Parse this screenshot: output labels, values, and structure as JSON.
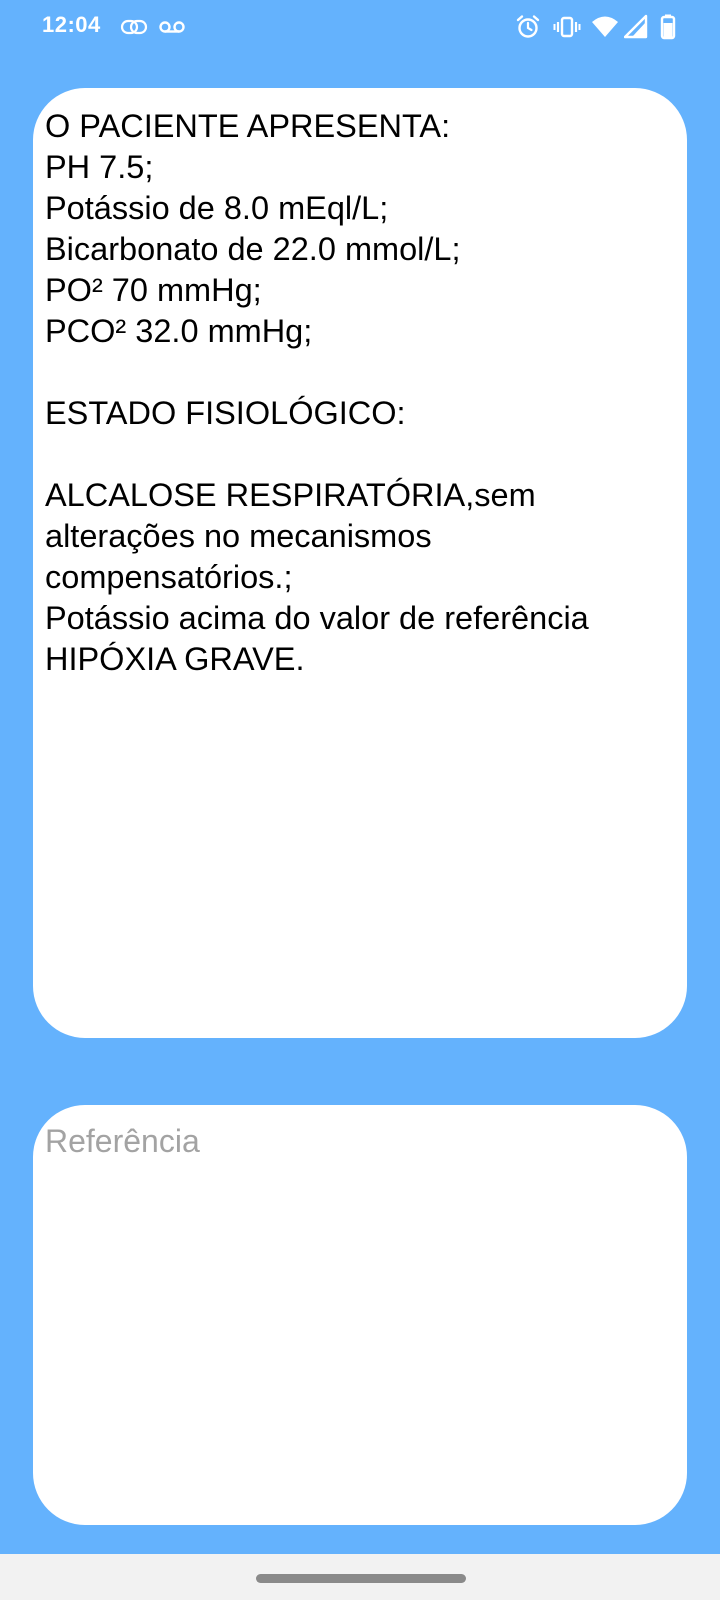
{
  "status_bar": {
    "time": "12:04",
    "left_icons": [
      "cloud-sync-icon",
      "voicemail-icon"
    ],
    "right_icons": [
      "alarm-icon",
      "vibrate-icon",
      "wifi-icon",
      "cellular-signal-icon",
      "battery-icon"
    ],
    "icon_color": "#ffffff"
  },
  "result": {
    "lines": [
      "O PACIENTE APRESENTA:",
      "PH 7.5;",
      "Potássio de 8.0 mEql/L;",
      "Bicarbonato de 22.0 mmol/L;",
      "PO² 70 mmHg;",
      "PCO² 32.0 mmHg;",
      "",
      "ESTADO FISIOLÓGICO:",
      "",
      "ALCALOSE RESPIRATÓRIA,sem",
      "alterações no mecanismos",
      "compensatórios.;",
      "Potássio acima do valor de referência",
      "HIPÓXIA GRAVE."
    ]
  },
  "reference": {
    "placeholder": "Referência",
    "value": ""
  },
  "colors": {
    "background": "#64b2fd",
    "card": "#ffffff",
    "placeholder": "#a3a3a3",
    "nav_bar": "#f2f2f2"
  }
}
